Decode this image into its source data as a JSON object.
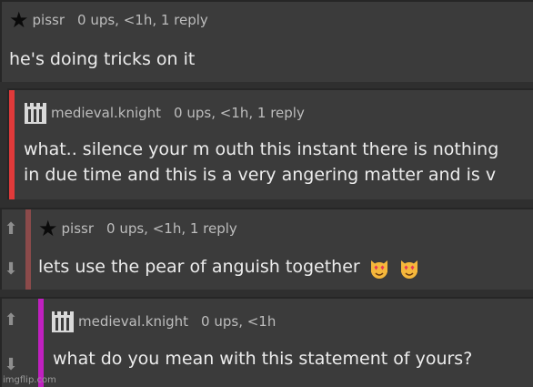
{
  "comments": [
    {
      "username": "pissr",
      "info": "0 ups, <1h, 1 reply",
      "body": "he's doing tricks on it",
      "avatar_icon": "star-icon"
    },
    {
      "username": "medieval.knight",
      "info": "0 ups, <1h, 1 reply",
      "body_line1": "what.. silence your m outh this instant there is nothing",
      "body_line2": "in due time and this is a very angering matter and is v",
      "avatar_icon": "castle-icon",
      "accent": "#e03a3a"
    },
    {
      "username": "pissr",
      "info": "0 ups, <1h, 1 reply",
      "body": "lets use the pear of anguish together",
      "avatar_icon": "star-icon",
      "accent": "#8b4a4a",
      "emojis": [
        "heart-eyes-cat-emoji",
        "heart-eyes-cat-emoji"
      ]
    },
    {
      "username": "medieval.knight",
      "info": "0 ups, <1h",
      "body": "what do you mean with this statement of yours?",
      "avatar_icon": "castle-icon",
      "accent": "#c020c0"
    }
  ],
  "watermark": "imgflip.com",
  "colors": {
    "panel": "#3b3b3b",
    "background": "#2f2f2f",
    "text": "#ececec",
    "meta": "#bdbdbd"
  }
}
